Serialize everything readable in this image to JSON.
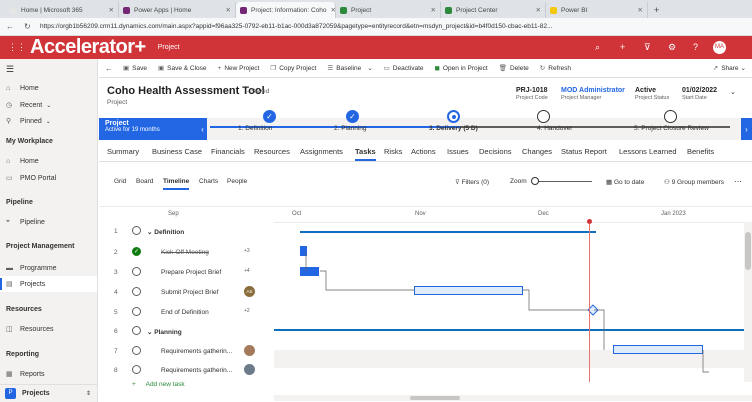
{
  "browser": {
    "tabs": [
      {
        "label": "Home | Microsoft 365",
        "color": "#e5e5e5"
      },
      {
        "label": "Power Apps | Home",
        "color": "#742774"
      },
      {
        "label": "Project: Information: Coho",
        "color": "#742774"
      },
      {
        "label": "Project",
        "color": "#2c8a3c"
      },
      {
        "label": "Project Center",
        "color": "#2c8a3c"
      },
      {
        "label": "Power BI",
        "color": "#f2c811"
      }
    ],
    "url": "https://orgb1b56209.crm11.dynamics.com/main.aspx?appid=f96aa325-0792-eb11-b1ac-000d3a872059&pagetype=entityrecord&etn=msdyn_project&id=b4f0d150-cbac-eb11-82..."
  },
  "app": {
    "logo": "Accelerator+",
    "name": "Project",
    "user_initials": "MA",
    "accent": "#d13438"
  },
  "sidebar": {
    "items": [
      {
        "label": "Home",
        "icon": "home-icon"
      },
      {
        "label": "Recent",
        "icon": "clock-icon"
      },
      {
        "label": "Pinned",
        "icon": "pin-icon"
      }
    ],
    "sections": [
      {
        "title": "My Workplace",
        "items": [
          "Home",
          "PMO Portal"
        ]
      },
      {
        "title": "Pipeline",
        "items": [
          "Pipeline"
        ]
      },
      {
        "title": "Project Management",
        "items": [
          "Programme",
          "Projects"
        ]
      },
      {
        "title": "Resources",
        "items": [
          "Resources"
        ]
      },
      {
        "title": "Reporting",
        "items": [
          "Reports"
        ]
      }
    ],
    "area": {
      "initial": "P",
      "label": "Projects"
    }
  },
  "commands": [
    "Save",
    "Save & Close",
    "New Project",
    "Copy Project",
    "Baseline",
    "Deactivate",
    "Open in Project",
    "Delete",
    "Refresh",
    "Share"
  ],
  "record": {
    "title": "Coho Health Assessment Tool",
    "saved": "- Saved",
    "type": "Project",
    "fields": [
      {
        "value": "PRJ-1018",
        "label": "Project Code"
      },
      {
        "value": "MOD Administrator",
        "label": "Project Manager"
      },
      {
        "value": "Active",
        "label": "Project Status"
      },
      {
        "value": "01/02/2022",
        "label": "Start Date"
      }
    ]
  },
  "stages": {
    "badge_title": "Project",
    "badge_sub": "Active for 19 months",
    "items": [
      "1. Definition",
      "2. Planning",
      "3. Delivery  (5 D)",
      "4. Handover",
      "5. Project Closure Review"
    ]
  },
  "tabs": [
    "Summary",
    "Business Case",
    "Financials",
    "Resources",
    "Assignments",
    "Tasks",
    "Risks",
    "Actions",
    "Issues",
    "Decisions",
    "Changes",
    "Status Report",
    "Lessons Learned",
    "Benefits"
  ],
  "views": [
    "Grid",
    "Board",
    "Timeline",
    "Charts",
    "People"
  ],
  "toolbar": {
    "filters": "Filters (0)",
    "zoom": "Zoom",
    "goto": "Go to date",
    "members": "9 Group members"
  },
  "timeline": {
    "months": [
      "Sep",
      "Oct",
      "Nov",
      "Dec",
      "Jan 2023"
    ]
  },
  "tasks": [
    {
      "n": "1",
      "name": "Definition",
      "summary": true
    },
    {
      "n": "2",
      "name": "Kick-Off Meeting",
      "badge": "+3",
      "done": true
    },
    {
      "n": "3",
      "name": "Prepare Project Brief",
      "badge": "+4"
    },
    {
      "n": "4",
      "name": "Submit Project Brief",
      "avatar": "AS"
    },
    {
      "n": "5",
      "name": "End of Definition",
      "badge": "+2"
    },
    {
      "n": "6",
      "name": "Planning",
      "summary": true
    },
    {
      "n": "7",
      "name": "Requirements gatherin..."
    },
    {
      "n": "8",
      "name": "Requirements gatherin..."
    }
  ],
  "add_task": "Add new task"
}
